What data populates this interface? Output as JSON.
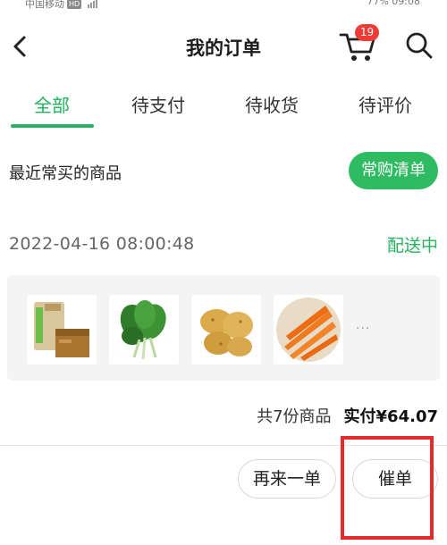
{
  "status_bar": {
    "carrier": "中国移动",
    "network_badge": "HD",
    "right_text": "77% 09:08"
  },
  "nav": {
    "title": "我的订单",
    "cart_count": "19",
    "back_icon": "chevron-left-icon",
    "cart_icon": "cart-icon",
    "search_icon": "search-icon"
  },
  "tabs": [
    {
      "label": "全部",
      "active": true
    },
    {
      "label": "待支付",
      "active": false
    },
    {
      "label": "待收货",
      "active": false
    },
    {
      "label": "待评价",
      "active": false
    }
  ],
  "recent": {
    "label": "最近常买的商品",
    "button": "常购清单"
  },
  "order": {
    "time": "2022-04-16 08:00:48",
    "status": "配送中",
    "products": [
      {
        "name": "packaged-goods"
      },
      {
        "name": "spinach"
      },
      {
        "name": "potatoes"
      },
      {
        "name": "carrots"
      }
    ],
    "more": "···",
    "count_text": "共7份商品",
    "paid_text": "实付¥64.07"
  },
  "actions": {
    "reorder": "再来一单",
    "urge": "催单"
  },
  "colors": {
    "accent": "#25b35d",
    "badge": "#ef3b36",
    "highlight": "#e62a2a"
  }
}
